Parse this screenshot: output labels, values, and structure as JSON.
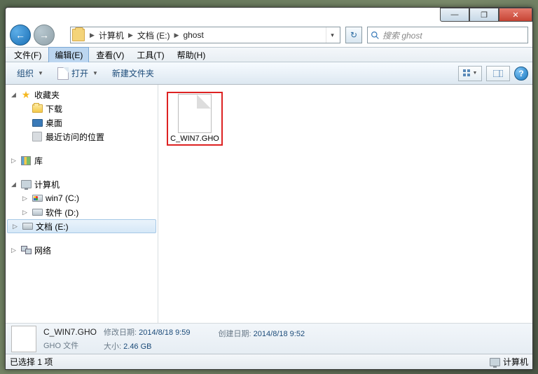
{
  "sysbtns": {
    "min": "—",
    "max": "❐",
    "close": "✕"
  },
  "nav": {
    "back": "←",
    "forward": "→",
    "hist": "▼"
  },
  "breadcrumbs": [
    "计算机",
    "文档 (E:)",
    "ghost"
  ],
  "search": {
    "placeholder": "搜索 ghost"
  },
  "menubar": [
    {
      "label": "文件(F)"
    },
    {
      "label": "编辑(E)",
      "selected": true
    },
    {
      "label": "查看(V)"
    },
    {
      "label": "工具(T)"
    },
    {
      "label": "帮助(H)"
    }
  ],
  "toolbar": {
    "organize": "组织",
    "open": "打开",
    "newfolder": "新建文件夹"
  },
  "sidebar": {
    "favorites": {
      "label": "收藏夹",
      "items": [
        "下载",
        "桌面",
        "最近访问的位置"
      ]
    },
    "libraries": {
      "label": "库"
    },
    "computer": {
      "label": "计算机",
      "drives": [
        "win7 (C:)",
        "软件 (D:)",
        "文档 (E:)"
      ]
    },
    "network": {
      "label": "网络"
    }
  },
  "file": {
    "name": "C_WIN7.GHO"
  },
  "details": {
    "filename": "C_WIN7.GHO",
    "filetype": "GHO 文件",
    "modified_label": "修改日期:",
    "modified_value": "2014/8/18 9:59",
    "size_label": "大小:",
    "size_value": "2.46 GB",
    "created_label": "创建日期:",
    "created_value": "2014/8/18 9:52"
  },
  "status": {
    "selection": "已选择 1 项",
    "location": "计算机"
  }
}
